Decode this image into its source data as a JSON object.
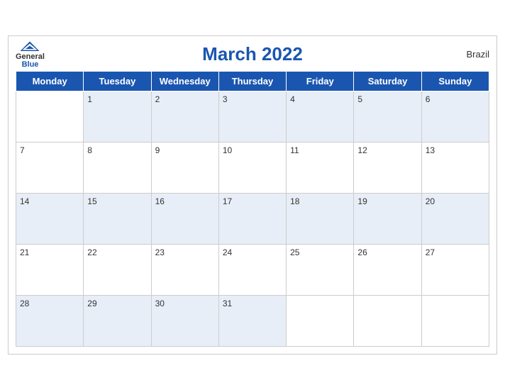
{
  "header": {
    "title": "March 2022",
    "country": "Brazil",
    "logo_general": "General",
    "logo_blue": "Blue"
  },
  "days_of_week": [
    "Monday",
    "Tuesday",
    "Wednesday",
    "Thursday",
    "Friday",
    "Saturday",
    "Sunday"
  ],
  "weeks": [
    [
      null,
      "1",
      "2",
      "3",
      "4",
      "5",
      "6"
    ],
    [
      "7",
      "8",
      "9",
      "10",
      "11",
      "12",
      "13"
    ],
    [
      "14",
      "15",
      "16",
      "17",
      "18",
      "19",
      "20"
    ],
    [
      "21",
      "22",
      "23",
      "24",
      "25",
      "26",
      "27"
    ],
    [
      "28",
      "29",
      "30",
      "31",
      null,
      null,
      null
    ]
  ]
}
